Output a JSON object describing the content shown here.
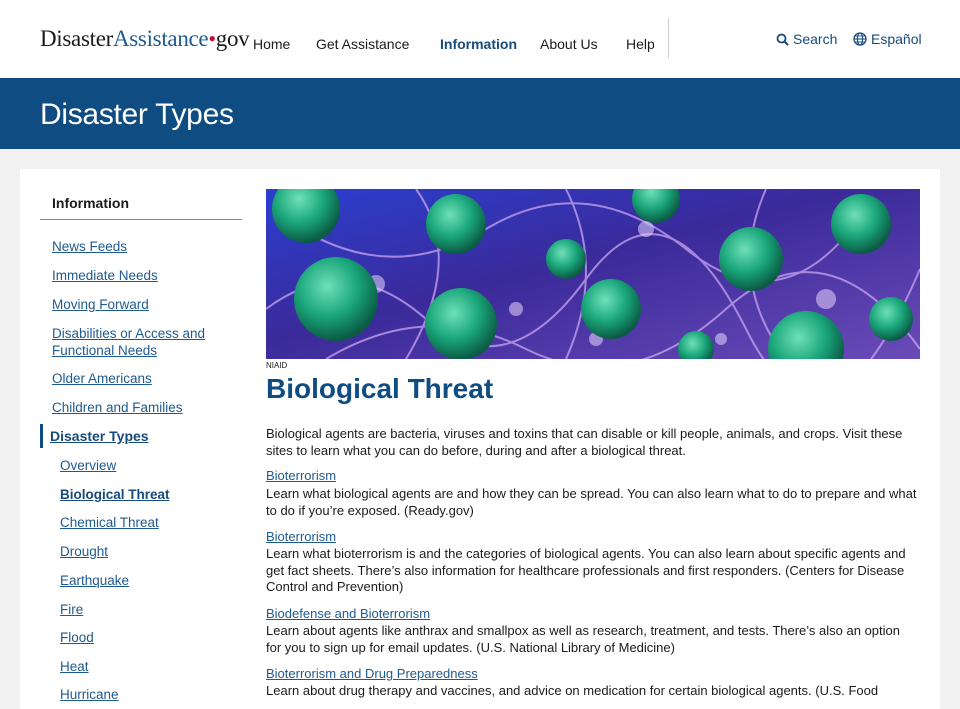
{
  "header": {
    "logo": {
      "part1": "Disaster",
      "part2": "Assistance",
      "part3": "gov"
    },
    "nav": [
      "Home",
      "Get Assistance",
      "Information",
      "About Us",
      "Help"
    ],
    "active_nav": "Information",
    "search_label": "Search",
    "language_label": "Español"
  },
  "banner": {
    "title": "Disaster Types"
  },
  "sidebar": {
    "title": "Information",
    "items": [
      "News Feeds",
      "Immediate Needs",
      "Moving Forward",
      "Disabilities or Access and Functional Needs",
      "Older Americans",
      "Children and Families"
    ],
    "section": "Disaster Types",
    "sub_items": [
      "Overview",
      "Biological Threat",
      "Chemical Threat",
      "Drought",
      "Earthquake",
      "Fire",
      "Flood",
      "Heat",
      "Hurricane"
    ],
    "current": "Biological Threat"
  },
  "main": {
    "image_credit": "NIAID",
    "title": "Biological Threat",
    "intro": "Biological agents are bacteria, viruses and toxins that can disable or kill people, animals, and crops. Visit these sites to learn what you can do before, during and after a biological threat.",
    "resources": [
      {
        "link": "Bioterrorism",
        "desc": "Learn what biological agents are and how they can be spread. You can also learn what to do to prepare and what to do if you’re exposed. (Ready.gov)"
      },
      {
        "link": "Bioterrorism",
        "desc": "Learn what bioterrorism is and the categories of biological agents. You can also learn about specific agents and get fact sheets. There’s also information for healthcare professionals and first responders. (Centers for Disease Control and Prevention)"
      },
      {
        "link": "Biodefense and Bioterrorism",
        "desc": "Learn about agents like anthrax and smallpox as well as research, treatment, and tests. There’s also an option for you to sign up for email updates. (U.S. National Library of Medicine)"
      },
      {
        "link": "Bioterrorism and Drug Preparedness",
        "desc": "Learn about drug therapy and vaccines, and advice on medication for certain biological agents. (U.S. Food"
      }
    ]
  },
  "colors": {
    "brand_blue": "#0f4c81",
    "link_blue": "#1f5a8f",
    "logo_red": "#c8102e"
  }
}
